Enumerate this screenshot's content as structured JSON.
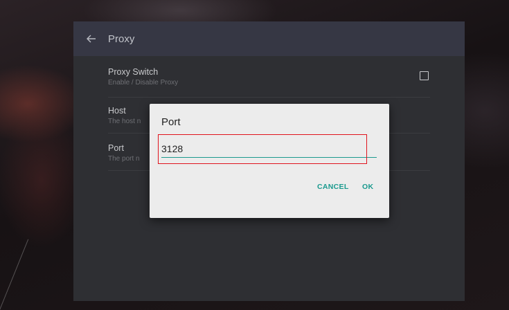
{
  "appbar": {
    "title": "Proxy",
    "back_icon": "arrow-left-icon"
  },
  "settings": [
    {
      "title": "Proxy Switch",
      "subtitle": "Enable / Disable Proxy"
    },
    {
      "title": "Host",
      "subtitle": "The host n"
    },
    {
      "title": "Port",
      "subtitle": "The port n"
    }
  ],
  "dialog": {
    "title": "Port",
    "input_value": "3128",
    "cancel_label": "CANCEL",
    "ok_label": "OK"
  },
  "colors": {
    "accent": "#1a9a8e",
    "highlight": "#e0121c",
    "appbar": "#363744",
    "panel": "#2e2f33"
  }
}
